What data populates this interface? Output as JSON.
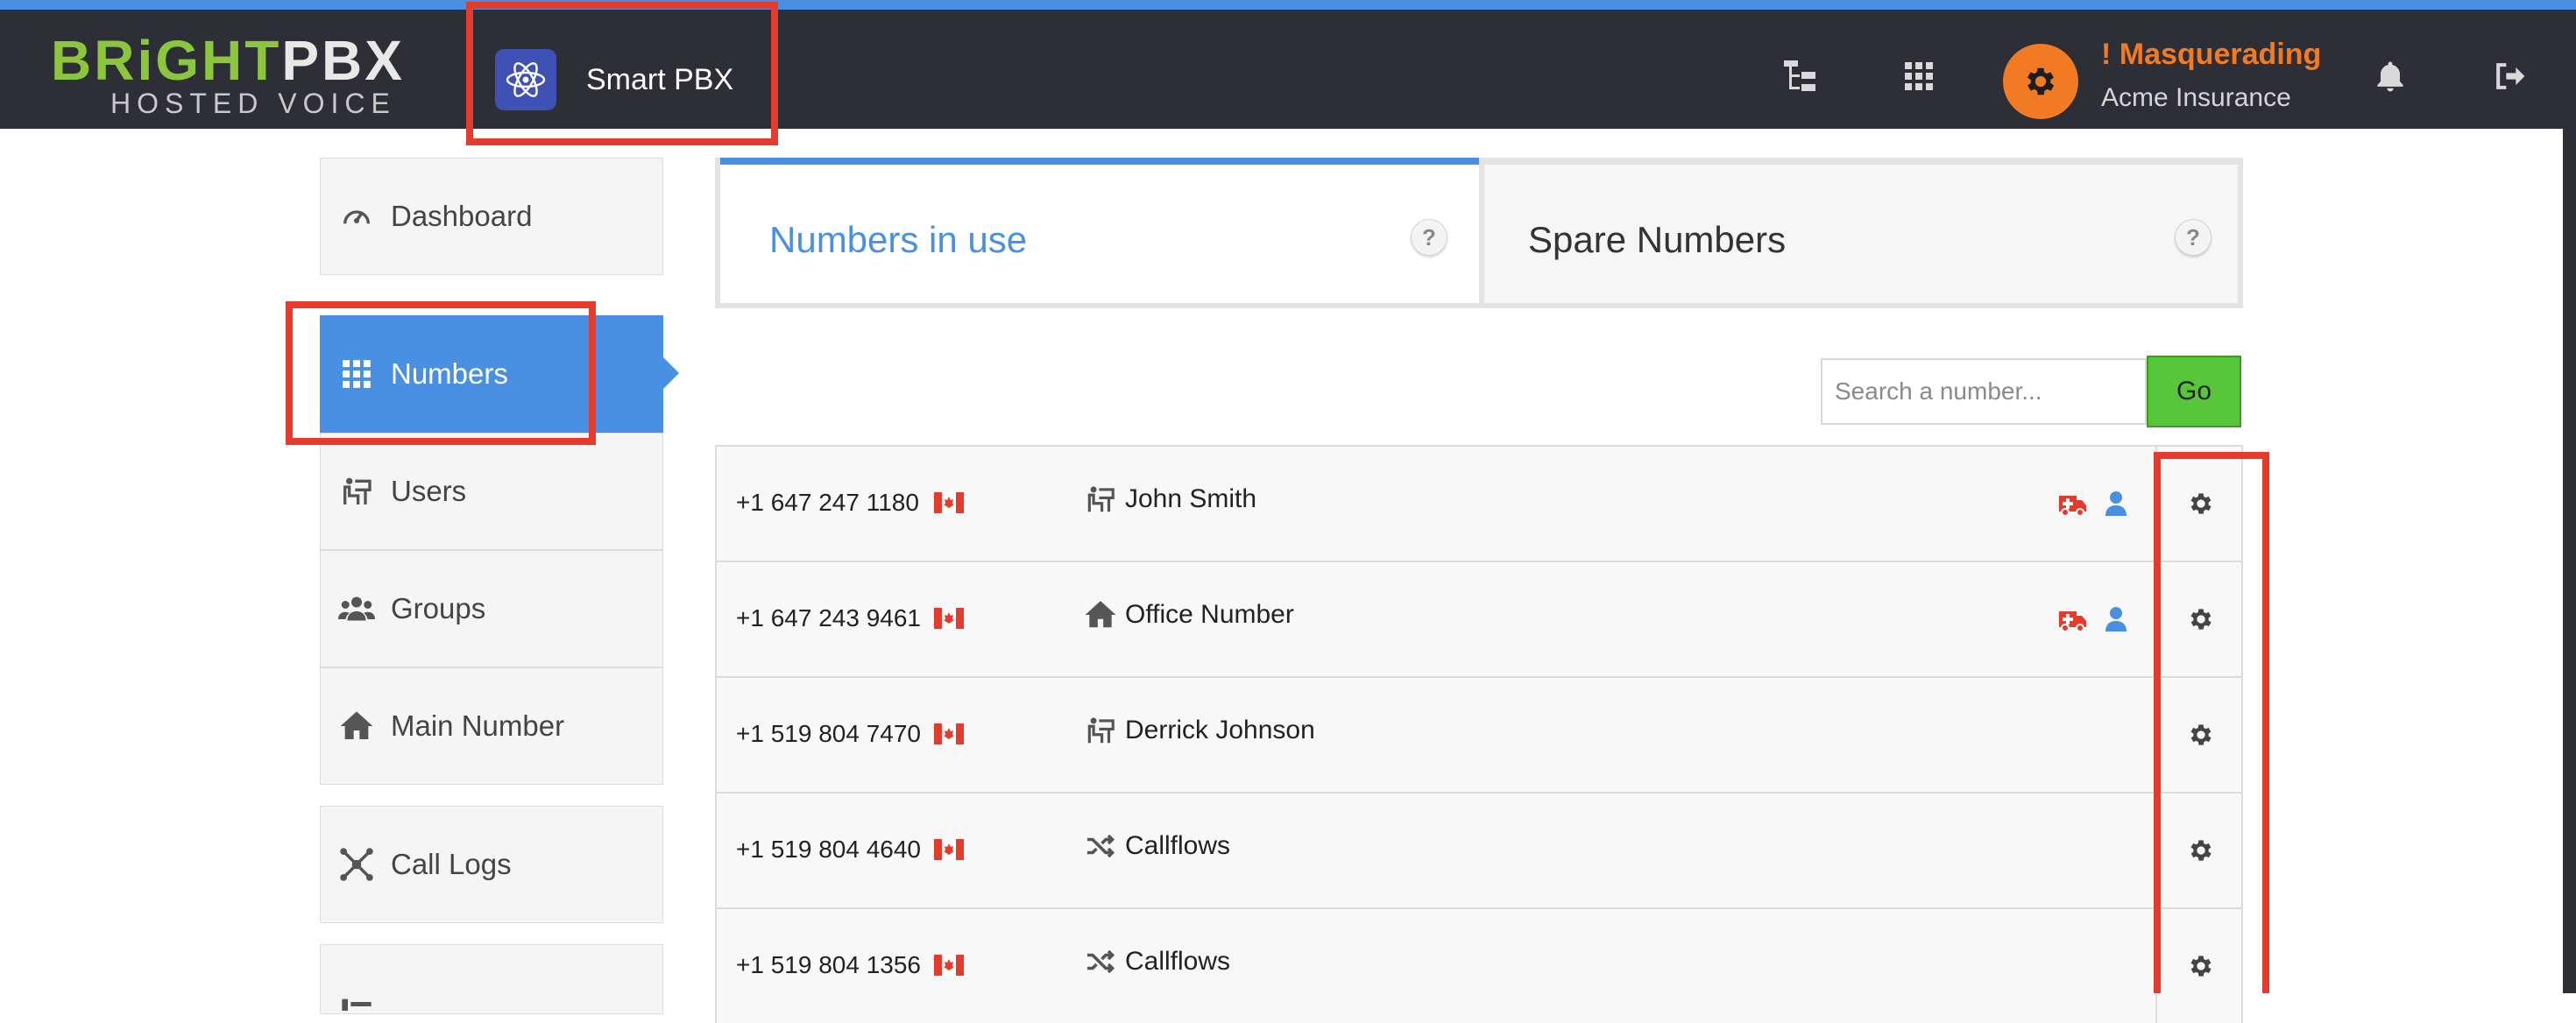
{
  "header": {
    "logo_line1_a": "BRiGHT",
    "logo_line1_b": "PBX",
    "logo_line2": "HOSTED VOICE",
    "app_name": "Smart PBX",
    "masquerade_label": "! Masquerading",
    "company_name": "Acme Insurance"
  },
  "sidebar": {
    "items": [
      {
        "label": "Dashboard",
        "icon": "dashboard-icon"
      },
      {
        "label": "Numbers",
        "icon": "grid-icon",
        "active": true
      },
      {
        "label": "Users",
        "icon": "user-desk-icon"
      },
      {
        "label": "Groups",
        "icon": "users-icon"
      },
      {
        "label": "Main Number",
        "icon": "home-icon"
      },
      {
        "label": "Call Logs",
        "icon": "hub-icon"
      }
    ]
  },
  "tabs": [
    {
      "label": "Numbers in use",
      "active": true,
      "help": "?"
    },
    {
      "label": "Spare Numbers",
      "active": false,
      "help": "?"
    }
  ],
  "search": {
    "placeholder": "Search a number...",
    "button": "Go"
  },
  "numbers": [
    {
      "number": "+1 647 247 1180",
      "assigned_to": "John Smith",
      "type_icon": "user-desk-icon",
      "badges": [
        "ambulance-icon",
        "user-icon"
      ]
    },
    {
      "number": "+1 647 243 9461",
      "assigned_to": "Office Number",
      "type_icon": "home-icon",
      "badges": [
        "ambulance-icon",
        "user-icon"
      ]
    },
    {
      "number": "+1 519 804 7470",
      "assigned_to": "Derrick Johnson",
      "type_icon": "user-desk-icon",
      "badges": []
    },
    {
      "number": "+1 519 804 4640",
      "assigned_to": "Callflows",
      "type_icon": "shuffle-icon",
      "badges": []
    },
    {
      "number": "+1 519 804 1356",
      "assigned_to": "Callflows",
      "type_icon": "shuffle-icon",
      "badges": []
    }
  ],
  "colors": {
    "accent": "#4a90e2",
    "header_bg": "#2d2e36",
    "brand_green": "#8cc63f",
    "orange": "#f17a24",
    "go_green": "#58c63a",
    "highlight_red": "#e53b2c",
    "badge_red": "#e53b2c"
  }
}
